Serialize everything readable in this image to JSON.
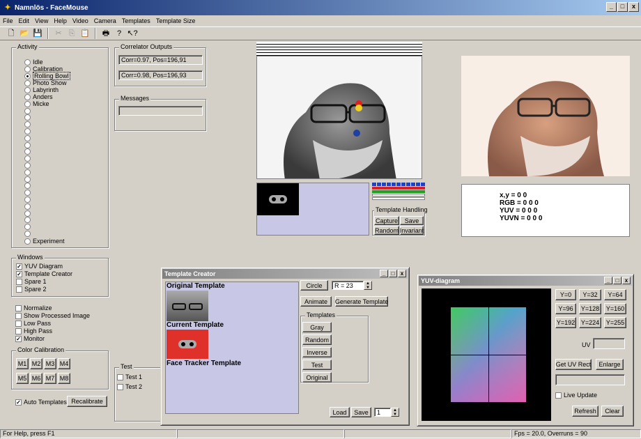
{
  "window": {
    "title": "Namnlös - FaceMouse",
    "min": "_",
    "max": "□",
    "close": "x"
  },
  "menu": [
    "File",
    "Edit",
    "View",
    "Help",
    "Video",
    "Camera",
    "Templates",
    "Template Size"
  ],
  "activity": {
    "label": "Activity",
    "items": [
      "Idle",
      "Calibration",
      "Rolling Bowl",
      "Photo Show",
      "Labyrinth",
      "Anders",
      "Micke"
    ],
    "selected": "Rolling Bowl",
    "experiment": "Experiment"
  },
  "correlator": {
    "label": "Correlator Outputs",
    "value1": "Corr=0.97, Pos=196,91",
    "value2": "Corr=0.98, Pos=196,93"
  },
  "messages": {
    "label": "Messages",
    "value": ""
  },
  "windows_group": {
    "label": "Windows",
    "items": [
      {
        "label": "YUV Diagram",
        "checked": true
      },
      {
        "label": "Template Creator",
        "checked": true
      },
      {
        "label": "Spare 1",
        "checked": false
      },
      {
        "label": "Spare 2",
        "checked": false
      }
    ]
  },
  "options": [
    {
      "label": "Normalize",
      "checked": false
    },
    {
      "label": "Show Processed Image",
      "checked": false
    },
    {
      "label": "Low Pass",
      "checked": false
    },
    {
      "label": "High Pass",
      "checked": false
    },
    {
      "label": "Monitor",
      "checked": true
    }
  ],
  "color_calibration": {
    "label": "Color Calibration",
    "buttons": [
      "M1",
      "M2",
      "M3",
      "M4",
      "M5",
      "M6",
      "M7",
      "M8"
    ]
  },
  "auto_templates": {
    "label": "Auto Templates",
    "checked": true
  },
  "recalibrate": "Recalibrate",
  "test_group": {
    "label": "Test",
    "items": [
      "Test 1",
      "Test 2"
    ]
  },
  "template_handling": {
    "label": "Template Handling",
    "capture": "Capture",
    "save": "Save",
    "random": "Random",
    "invariant": "Invariant"
  },
  "readout": {
    "xy": "x,y = 0 0",
    "rgb": "RGB = 0 0 0",
    "yuv": "YUV = 0 0 0",
    "yuvn": "YUVN = 0 0 0"
  },
  "template_creator": {
    "title": "Template Creator",
    "original_template": "Original Template",
    "current_template": "Current Template",
    "face_tracker_template": "Face Tracker Template",
    "circle": "Circle",
    "radius": "R = 23",
    "animate": "Animate",
    "generate_template": "Generate Template",
    "templates_label": "Templates",
    "template_buttons": [
      "Gray",
      "Random",
      "Inverse",
      "Test",
      "Original"
    ],
    "load": "Load",
    "save": "Save",
    "index": "1"
  },
  "yuv_diagram": {
    "title": "YUV-diagram",
    "y_buttons": [
      "Y=0",
      "Y=32",
      "Y=64",
      "Y=96",
      "Y=128",
      "Y=160",
      "Y=192",
      "Y=224",
      "Y=255"
    ],
    "uv_label": "UV",
    "uv_value": "",
    "get_uv_rect": "Get UV Rect",
    "enlarge": "Enlarge",
    "uv_rect_value": "",
    "live_update": "Live Update",
    "live_update_checked": false,
    "refresh": "Refresh",
    "clear": "Clear"
  },
  "status": {
    "help": "For Help, press F1",
    "fps": "Fps = 20.0,  Overruns = 90"
  },
  "colors": {
    "titlebar": "#0a246a",
    "template_bg": "#c8c8e6",
    "template_red": "#e0302a",
    "marker_red": "#e02020",
    "marker_yellow": "#f0d020",
    "marker_blue": "#2040a0"
  }
}
